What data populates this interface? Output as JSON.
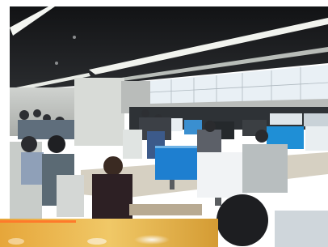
{
  "photo": {
    "subject": "open-plan-office-room",
    "colors": {
      "ceiling": "#1b1c1e",
      "ceiling_light": "#f4f6f2",
      "wall": "#d9dcd8",
      "video_wall": "#e9f0f5",
      "monitor_blue": "#1f8fd6",
      "desk": "#d6d0c2",
      "floor_amber": "#e2b04a",
      "chair": "#c8ccc9"
    }
  }
}
